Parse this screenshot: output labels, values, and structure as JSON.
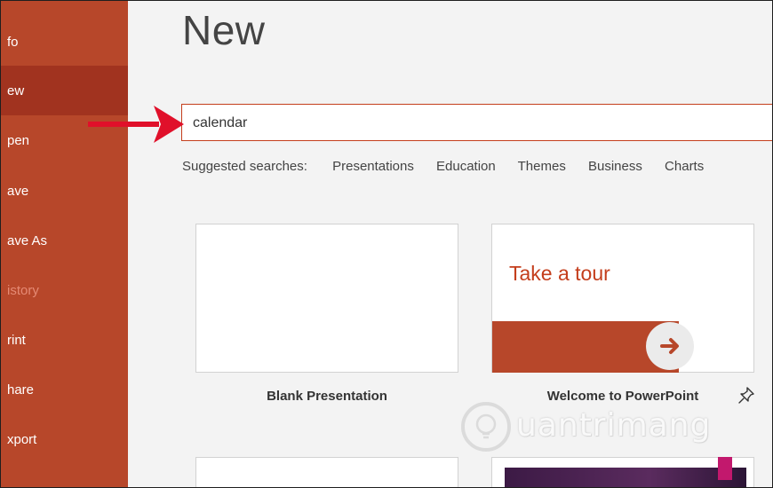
{
  "nav": {
    "items": [
      {
        "label": "fo",
        "state": "normal"
      },
      {
        "label": "ew",
        "state": "active"
      },
      {
        "label": "pen",
        "state": "normal"
      },
      {
        "label": "ave",
        "state": "normal"
      },
      {
        "label": "ave As",
        "state": "normal"
      },
      {
        "label": "istory",
        "state": "disabled"
      },
      {
        "label": "rint",
        "state": "normal"
      },
      {
        "label": "hare",
        "state": "normal"
      },
      {
        "label": "xport",
        "state": "normal"
      }
    ]
  },
  "main": {
    "title": "New",
    "search": {
      "value": "calendar"
    },
    "suggested": {
      "label": "Suggested searches:",
      "links": [
        "Presentations",
        "Education",
        "Themes",
        "Business",
        "Charts"
      ]
    },
    "templates": [
      {
        "label": "Blank Presentation"
      },
      {
        "label": "Welcome to PowerPoint",
        "thumb_text": "Take a tour",
        "pin_icon": "pin-icon"
      }
    ]
  },
  "watermark": {
    "text": "uantrimang"
  },
  "colors": {
    "accent": "#b7472a",
    "accent_active": "#a1331f",
    "arrow": "#e0102a",
    "search_border": "#c43e1c"
  }
}
